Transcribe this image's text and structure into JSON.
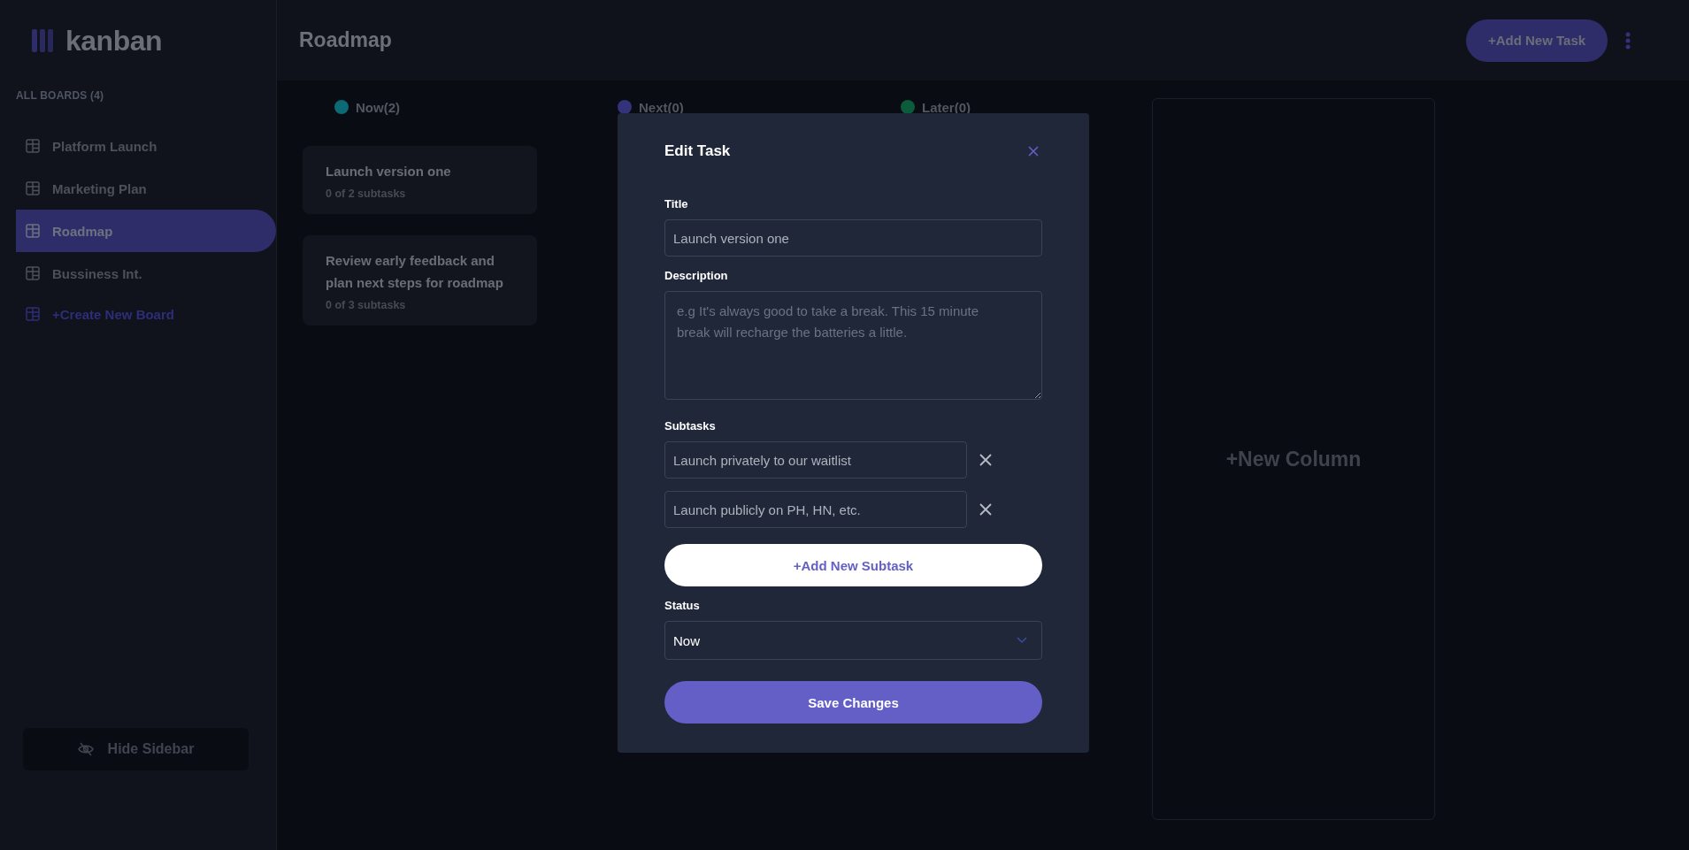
{
  "sidebar": {
    "logo": "kanban",
    "boards_heading": "ALL BOARDS (4)",
    "boards": [
      {
        "label": "Platform Launch",
        "selected": false
      },
      {
        "label": "Marketing Plan",
        "selected": false
      },
      {
        "label": "Roadmap",
        "selected": true
      },
      {
        "label": "Bussiness Int.",
        "selected": false
      }
    ],
    "create_board": "+Create New Board",
    "hide_sidebar": "Hide Sidebar"
  },
  "header": {
    "title": "Roadmap",
    "add_task": "+Add New Task"
  },
  "columns": [
    {
      "name": "Now(2)",
      "color": "#0b6a73",
      "cards": [
        {
          "title": "Launch version one",
          "subtasks": "0 of 2 subtasks"
        },
        {
          "title": "Review early feedback and plan next steps for roadmap",
          "subtasks": "0 of 3 subtasks"
        }
      ]
    },
    {
      "name": "Next(0)",
      "color": "#34327a"
    },
    {
      "name": "Later(0)",
      "color": "#0b5c3c"
    }
  ],
  "new_column": "+New Column",
  "modal": {
    "heading": "Edit Task",
    "title_label": "Title",
    "title_value": "Launch version one",
    "description_label": "Description",
    "description_placeholder": "e.g It's always good to take a break. This 15 minute break will recharge the batteries a little.",
    "subtasks_label": "Subtasks",
    "subtasks": [
      "Launch privately to our waitlist",
      "Launch publicly on PH, HN, etc."
    ],
    "add_subtask": "+Add New Subtask",
    "status_label": "Status",
    "status_value": "Now",
    "save": "Save Changes"
  }
}
